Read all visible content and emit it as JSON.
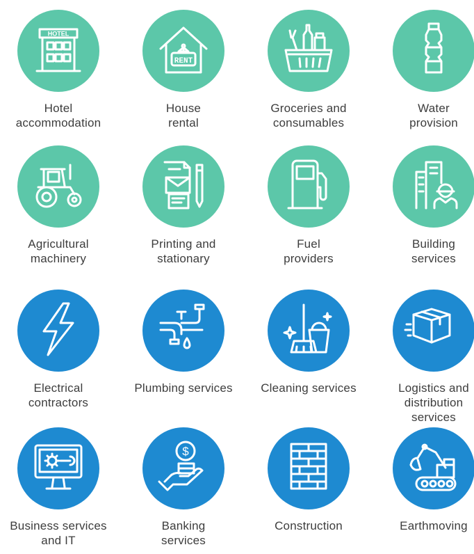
{
  "colors": {
    "teal": "#5cc7a9",
    "blue": "#1e8ad1",
    "icon_stroke": "#ffffff",
    "text": "#3d3d3d"
  },
  "services": [
    {
      "lines": [
        "Hotel",
        "accommodation"
      ],
      "icon": "hotel-building-icon",
      "sign_text": "HOTEL",
      "color": "teal"
    },
    {
      "lines": [
        "House",
        "rental"
      ],
      "icon": "house-rent-sign-icon",
      "sign_text": "RENT",
      "color": "teal"
    },
    {
      "lines": [
        "Groceries and",
        "consumables"
      ],
      "icon": "grocery-basket-icon",
      "color": "teal"
    },
    {
      "lines": [
        "Water",
        "provision"
      ],
      "icon": "water-bottle-icon",
      "color": "teal"
    },
    {
      "lines": [
        "Agricultural",
        "machinery"
      ],
      "icon": "tractor-icon",
      "color": "teal"
    },
    {
      "lines": [
        "Printing and",
        "stationary"
      ],
      "icon": "stationery-documents-icon",
      "color": "teal"
    },
    {
      "lines": [
        "Fuel",
        "providers"
      ],
      "icon": "fuel-pump-icon",
      "color": "teal"
    },
    {
      "lines": [
        "Building",
        "services"
      ],
      "icon": "building-worker-icon",
      "color": "teal"
    },
    {
      "lines": [
        "Electrical",
        "contractors"
      ],
      "icon": "lightning-bolt-icon",
      "color": "blue"
    },
    {
      "lines": [
        "Plumbing services"
      ],
      "icon": "plumbing-pipe-icon",
      "color": "blue"
    },
    {
      "lines": [
        "Cleaning services"
      ],
      "icon": "cleaning-broom-bucket-icon",
      "color": "blue"
    },
    {
      "lines": [
        "Logistics and",
        "distribution",
        "services"
      ],
      "icon": "delivery-box-icon",
      "color": "blue"
    },
    {
      "lines": [
        "Business services",
        "and IT"
      ],
      "icon": "computer-gear-icon",
      "color": "blue"
    },
    {
      "lines": [
        "Banking",
        "services"
      ],
      "icon": "hand-coin-icon",
      "color": "blue"
    },
    {
      "lines": [
        "Construction"
      ],
      "icon": "brick-wall-icon",
      "color": "blue"
    },
    {
      "lines": [
        "Earthmoving"
      ],
      "icon": "excavator-icon",
      "color": "blue"
    }
  ]
}
